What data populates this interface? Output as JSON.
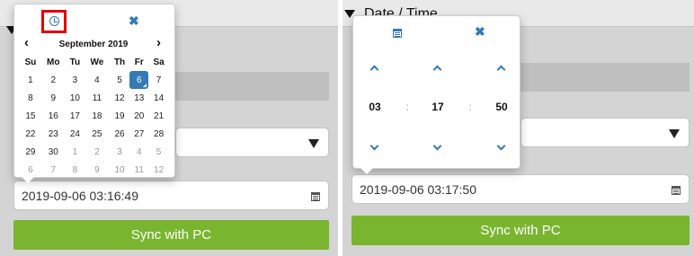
{
  "datetime_section": {
    "header_label": "Date / Time"
  },
  "left_panel": {
    "datetime_value": "2019-09-06 03:16:49",
    "sync_label": "Sync with PC",
    "picker": {
      "close_glyph": "✖",
      "prev_glyph": "‹",
      "next_glyph": "›",
      "month_title": "September 2019",
      "weekdays": [
        "Su",
        "Mo",
        "Tu",
        "We",
        "Th",
        "Fr",
        "Sa"
      ],
      "weeks": [
        [
          "1",
          "2",
          "3",
          "4",
          "5",
          "6",
          "7"
        ],
        [
          "8",
          "9",
          "10",
          "11",
          "12",
          "13",
          "14"
        ],
        [
          "15",
          "16",
          "17",
          "18",
          "19",
          "20",
          "21"
        ],
        [
          "22",
          "23",
          "24",
          "25",
          "26",
          "27",
          "28"
        ],
        [
          "29",
          "30",
          "1",
          "2",
          "3",
          "4",
          "5"
        ],
        [
          "6",
          "7",
          "8",
          "9",
          "10",
          "11",
          "12"
        ]
      ],
      "selected_day": "6"
    }
  },
  "right_panel": {
    "datetime_value": "2019-09-06 03:17:50",
    "sync_label": "Sync with PC",
    "picker": {
      "close_glyph": "✖",
      "hours": "03",
      "minutes": "17",
      "seconds": "50",
      "separator": ":"
    }
  },
  "colors": {
    "accent": "#337ab7",
    "sync_button": "#79b52f",
    "highlight_box": "#e00000"
  }
}
